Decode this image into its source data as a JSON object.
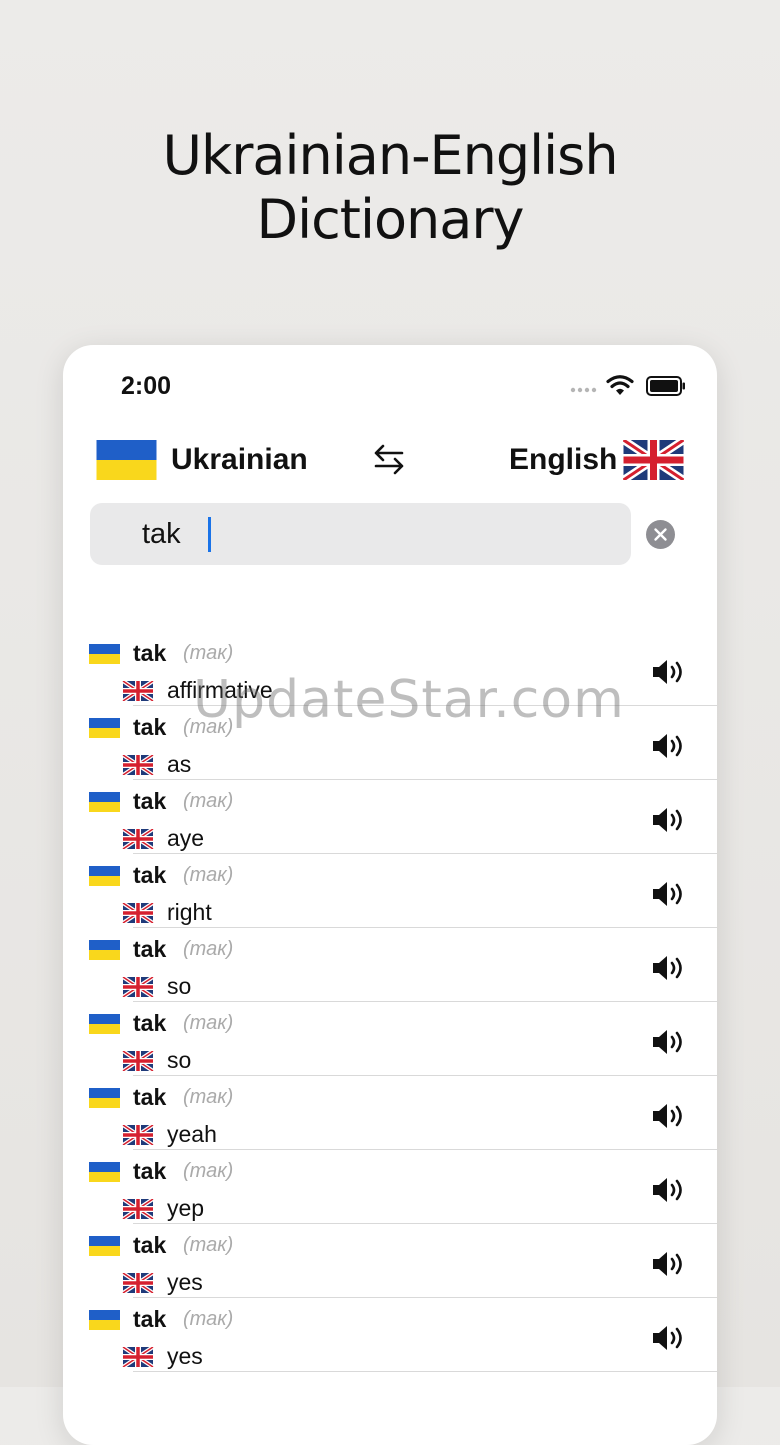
{
  "headline": {
    "line1": "Ukrainian-English",
    "line2": "Dictionary"
  },
  "status_bar": {
    "time": "2:00"
  },
  "language_bar": {
    "source": "Ukrainian",
    "target": "English"
  },
  "search": {
    "value": "tak",
    "placeholder": ""
  },
  "results": [
    {
      "word": "tak",
      "translit": "(так)",
      "translation": "affirmative"
    },
    {
      "word": "tak",
      "translit": "(так)",
      "translation": "as"
    },
    {
      "word": "tak",
      "translit": "(так)",
      "translation": "aye"
    },
    {
      "word": "tak",
      "translit": "(так)",
      "translation": "right"
    },
    {
      "word": "tak",
      "translit": "(так)",
      "translation": "so"
    },
    {
      "word": "tak",
      "translit": "(так)",
      "translation": "so"
    },
    {
      "word": "tak",
      "translit": "(так)",
      "translation": "yeah"
    },
    {
      "word": "tak",
      "translit": "(так)",
      "translation": "yep"
    },
    {
      "word": "tak",
      "translit": "(так)",
      "translation": "yes"
    },
    {
      "word": "tak",
      "translit": "(так)",
      "translation": "yes"
    }
  ],
  "watermark": "UpdateStar.com",
  "colors": {
    "ua_blue": "#1f5fc8",
    "ua_yellow": "#f9d71c",
    "uk_blue": "#1f3a7a",
    "uk_red": "#d5202f",
    "caret": "#1a73e8"
  }
}
